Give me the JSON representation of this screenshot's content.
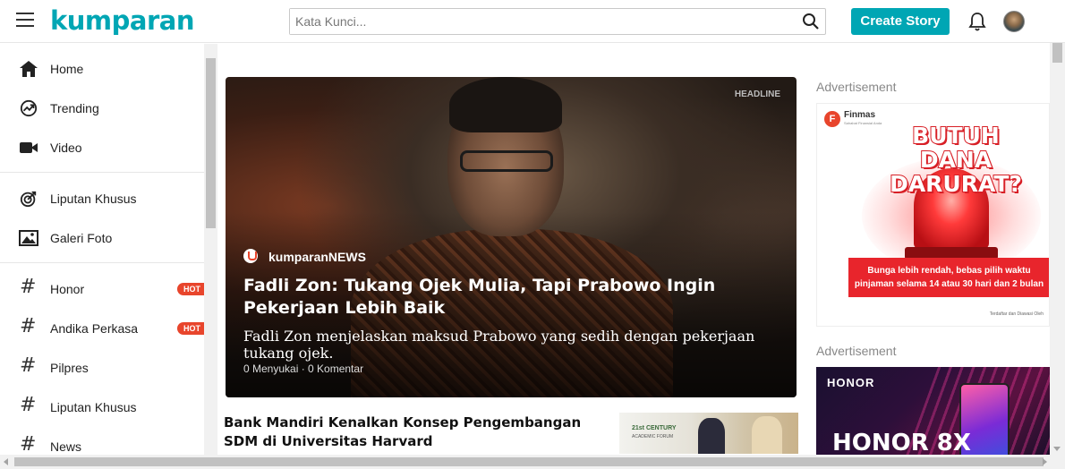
{
  "header": {
    "logo": "kumparan",
    "search_placeholder": "Kata Kunci...",
    "create_label": "Create Story"
  },
  "sidebar": {
    "main_items": [
      {
        "label": "Home",
        "icon": "home-icon"
      },
      {
        "label": "Trending",
        "icon": "trending-icon"
      },
      {
        "label": "Video",
        "icon": "video-icon"
      }
    ],
    "feature_items": [
      {
        "label": "Liputan Khusus",
        "icon": "target-icon"
      },
      {
        "label": "Galeri Foto",
        "icon": "image-icon"
      }
    ],
    "topics": [
      {
        "label": "Honor",
        "badge": "HOT"
      },
      {
        "label": "Andika Perkasa",
        "badge": "HOT"
      },
      {
        "label": "Pilpres",
        "badge": ""
      },
      {
        "label": "Liputan Khusus",
        "badge": ""
      },
      {
        "label": "News",
        "badge": ""
      }
    ]
  },
  "headline": {
    "tag": "HEADLINE",
    "source": "kumparanNEWS",
    "title": "Fadli Zon: Tukang Ojek Mulia, Tapi Prabowo Ingin Pekerjaan Lebih Baik",
    "description": "Fadli Zon menjelaskan maksud Prabowo yang sedih dengan pekerjaan tukang ojek.",
    "meta": "0 Menyukai · 0 Komentar"
  },
  "stories": [
    {
      "title": "Bank Mandiri Kenalkan Konsep Pengembangan SDM di Universitas Harvard",
      "thumb_text_1": "21st CENTURY",
      "thumb_text_2": "ACADEMIC FORUM"
    }
  ],
  "ads": {
    "label": "Advertisement",
    "finmas": {
      "brand": "Finmas",
      "brand_sub": "Sahabat Finansial Anda",
      "headline": "BUTUH DANA DARURAT?",
      "body": "Bunga lebih rendah, bebas pilih waktu pinjaman selama 14 atau 30 hari dan 2 bulan",
      "footer": "Terdaftar dan Diawasi Oleh"
    },
    "honor": {
      "brand": "HONOR",
      "model": "HONOR 8X"
    }
  },
  "colors": {
    "brand": "#00a6b4",
    "hot_badge": "#e8452c"
  }
}
